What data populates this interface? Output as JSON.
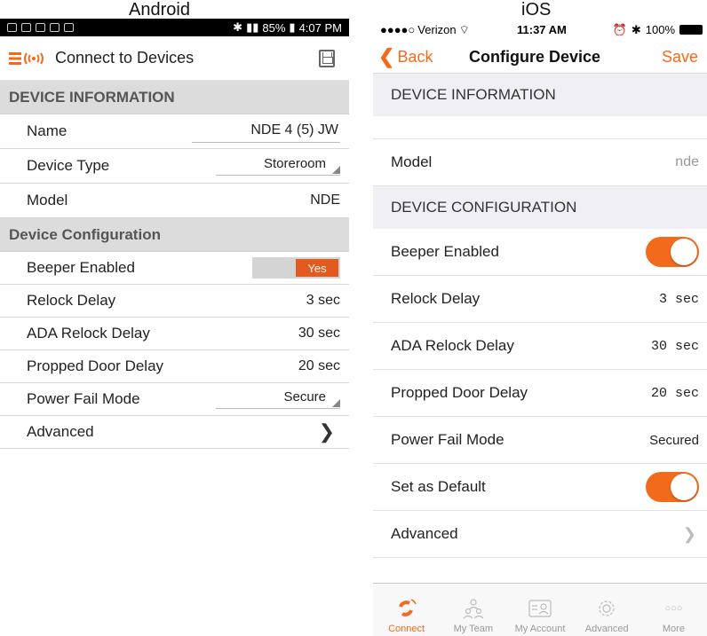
{
  "labels": {
    "android": "Android",
    "ios": "iOS"
  },
  "android": {
    "status": {
      "battery": "85%",
      "time": "4:07 PM"
    },
    "appbar": {
      "title": "Connect to Devices"
    },
    "sections": {
      "device_info": "DEVICE INFORMATION",
      "device_config": "Device Configuration"
    },
    "fields": {
      "name_label": "Name",
      "name_value": "NDE 4 (5) JW",
      "device_type_label": "Device Type",
      "device_type_value": "Storeroom",
      "model_label": "Model",
      "model_value": "NDE",
      "beeper_label": "Beeper Enabled",
      "beeper_value": "Yes",
      "relock_label": "Relock Delay",
      "relock_value": "3 sec",
      "ada_label": "ADA Relock Delay",
      "ada_value": "30 sec",
      "propped_label": "Propped Door Delay",
      "propped_value": "20 sec",
      "powerfail_label": "Power Fail Mode",
      "powerfail_value": "Secure",
      "advanced_label": "Advanced"
    }
  },
  "ios": {
    "status": {
      "carrier": "Verizon",
      "time": "11:37 AM",
      "battery": "100%"
    },
    "nav": {
      "back": "Back",
      "title": "Configure Device",
      "save": "Save"
    },
    "sections": {
      "device_info": "DEVICE INFORMATION",
      "device_config": "DEVICE CONFIGURATION"
    },
    "fields": {
      "model_label": "Model",
      "model_value": "nde",
      "beeper_label": "Beeper Enabled",
      "relock_label": "Relock Delay",
      "relock_value": "3 sec",
      "ada_label": "ADA Relock Delay",
      "ada_value": "30 sec",
      "propped_label": "Propped Door Delay",
      "propped_value": "20 sec",
      "powerfail_label": "Power Fail Mode",
      "powerfail_value": "Secured",
      "default_label": "Set as Default",
      "advanced_label": "Advanced"
    },
    "tabs": [
      {
        "label": "Connect",
        "icon": "connect-icon"
      },
      {
        "label": "My Team",
        "icon": "team-icon"
      },
      {
        "label": "My Account",
        "icon": "account-icon"
      },
      {
        "label": "Advanced",
        "icon": "gear-icon"
      },
      {
        "label": "More",
        "icon": "more-icon"
      }
    ]
  },
  "colors": {
    "accent": "#f26b1d",
    "android_toggle": "#e35a1e"
  }
}
